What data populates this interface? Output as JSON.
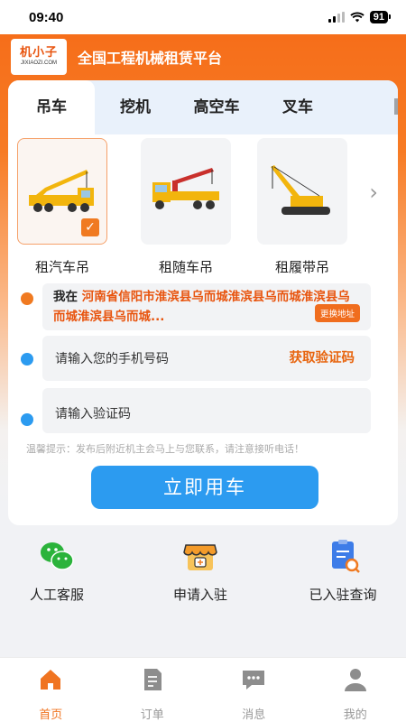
{
  "status": {
    "time": "09:40",
    "battery": "91"
  },
  "header": {
    "logo_cn": "机小子",
    "logo_en": "JIXIAOZI.COM",
    "title": "全国工程机械租赁平台"
  },
  "tabs": [
    {
      "label": "吊车",
      "active": true
    },
    {
      "label": "挖机"
    },
    {
      "label": "高空车"
    },
    {
      "label": "叉车"
    }
  ],
  "machines": [
    {
      "label": "租汽车吊",
      "selected": true
    },
    {
      "label": "租随车吊"
    },
    {
      "label": "租履带吊"
    }
  ],
  "address": {
    "prefix": "我在",
    "value": "河南省信阳市淮滨县乌而城淮滨县乌而城淮滨县乌而城淮滨县乌而城...",
    "change_label": "更换地址"
  },
  "phone": {
    "placeholder": "请输入您的手机号码",
    "get_code_label": "获取验证码"
  },
  "code": {
    "placeholder": "请输入验证码"
  },
  "tip": "温馨提示：发布后附近机主会马上与您联系，请注意接听电话！",
  "submit_label": "立即用车",
  "services": [
    {
      "label": "人工客服",
      "icon": "wechat-icon"
    },
    {
      "label": "申请入驻",
      "icon": "shop-icon"
    },
    {
      "label": "已入驻查询",
      "icon": "search-document-icon"
    }
  ],
  "tabbar": [
    {
      "label": "首页",
      "icon": "home-icon",
      "active": true
    },
    {
      "label": "订单",
      "icon": "order-icon"
    },
    {
      "label": "消息",
      "icon": "message-icon"
    },
    {
      "label": "我的",
      "icon": "user-icon"
    }
  ],
  "colors": {
    "brand_orange": "#f06d1e",
    "primary_blue": "#2c9bf0",
    "dot_orange": "#f07a21",
    "dot_blue": "#2c9bf0"
  }
}
